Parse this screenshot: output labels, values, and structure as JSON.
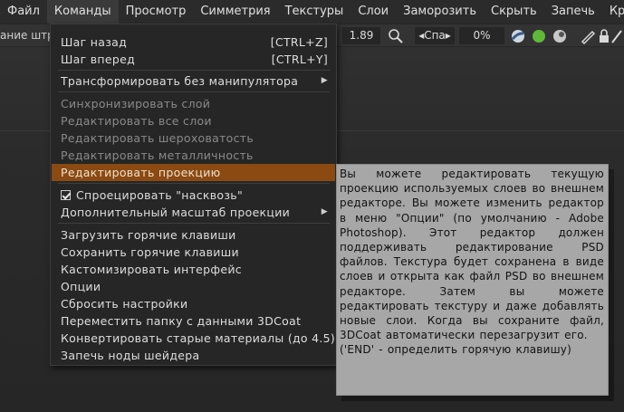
{
  "menubar": {
    "items": [
      "Файл",
      "Команды",
      "Просмотр",
      "Симметрия",
      "Текстуры",
      "Слои",
      "Заморозить",
      "Скрыть",
      "Запечь",
      "Кривые"
    ]
  },
  "toolbar": {
    "left_text": "ание штр",
    "value_field": "1.89",
    "mode_field": "◂Спа▸",
    "percent_field": "0%",
    "icons": [
      "brush-icon",
      "circle-icon",
      "green-dot-icon",
      "pen-icon",
      "lock-icon",
      "slash-icon"
    ],
    "colors": {
      "green": "#5fb83a"
    }
  },
  "dropdown": {
    "items": [
      {
        "label": "Шаг назад",
        "shortcut": "[CTRL+Z]"
      },
      {
        "label": "Шаг вперед",
        "shortcut": "[CTRL+Y]"
      },
      {
        "label": "Трансформировать без манипулятора",
        "submenu": true
      },
      {
        "label": "Синхронизировать слой",
        "disabled": true
      },
      {
        "label": "Редактировать все слои",
        "disabled": true
      },
      {
        "label": "Редактировать шероховатость",
        "disabled": true
      },
      {
        "label": "Редактировать металличность",
        "disabled": true
      },
      {
        "label": "Редактировать проекцию",
        "highlight": true
      },
      {
        "label": "Спроецировать \"насквозь\"",
        "checked": true
      },
      {
        "label": "Дополнительный масштаб проекции",
        "submenu": true
      },
      {
        "label": "Загрузить горячие клавиши"
      },
      {
        "label": "Сохранить горячие клавиши"
      },
      {
        "label": "Кастомизировать интерфейс"
      },
      {
        "label": "Опции"
      },
      {
        "label": "Сбросить настройки"
      },
      {
        "label": "Переместить папку с данными 3DCoat"
      },
      {
        "label": "Конвертировать старые материалы (до 4.5)"
      },
      {
        "label": "Запечь ноды шейдера"
      }
    ],
    "highlight_color": "#8a4a12"
  },
  "tooltip": {
    "text": "Вы можете редактировать текущую проекцию используемых слоев во внешнем редакторе. Вы можете изменить редактор в меню \"Опции\" (по умолчанию - Adobe Photoshop). Этот редактор должен поддерживать редактирование PSD файлов. Текстура будет сохранена в виде слоев и открыта как файл PSD во внешнем редакторе. Затем вы можете редактировать текстуру и даже добавлять новые слои. Когда вы сохраните файл, 3DCoat автоматически перезагрузит его.",
    "hotkey_hint": "('END' - определить горячую клавишу)"
  }
}
